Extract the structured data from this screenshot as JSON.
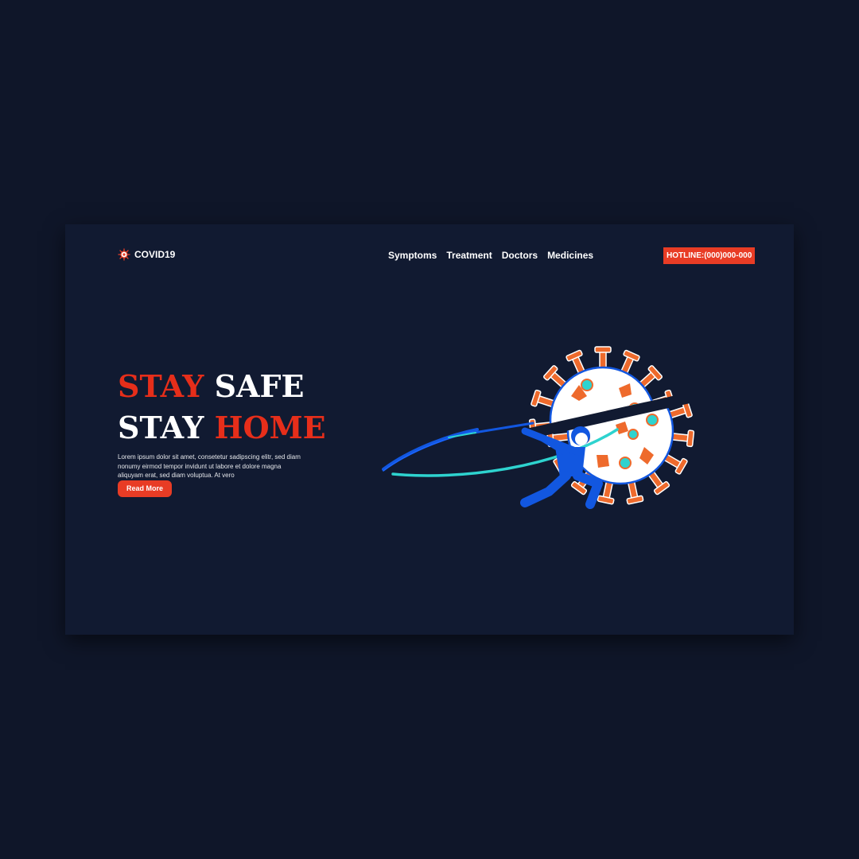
{
  "header": {
    "logo_text": "COVID19",
    "logo_icon": "virus-icon",
    "nav": [
      {
        "label": "Symptoms"
      },
      {
        "label": "Treatment"
      },
      {
        "label": "Doctors"
      },
      {
        "label": "Medicines"
      }
    ],
    "hotline_label": "HOTLINE:(000)000-000"
  },
  "hero": {
    "headline_line1_word1": "STAY",
    "headline_line1_word2": "SAFE",
    "headline_line2_word1": "STAY",
    "headline_line2_word2": "HOME",
    "description": "Lorem ipsum dolor sit amet, consetetur sadipscing elitr, sed diam nonumy eirmod tempor invidunt ut labore et dolore magna aliquyam erat, sed diam voluptua. At vero",
    "read_more_label": "Read More"
  },
  "illustration": {
    "subject": "ninja-slicing-virus-illustration"
  },
  "colors": {
    "background": "#0f1629",
    "card": "#111a31",
    "accent_red": "#e83c25",
    "ninja_blue": "#1257e0",
    "virus_orange": "#ee6a2c",
    "virus_teal": "#2ed3cf"
  }
}
